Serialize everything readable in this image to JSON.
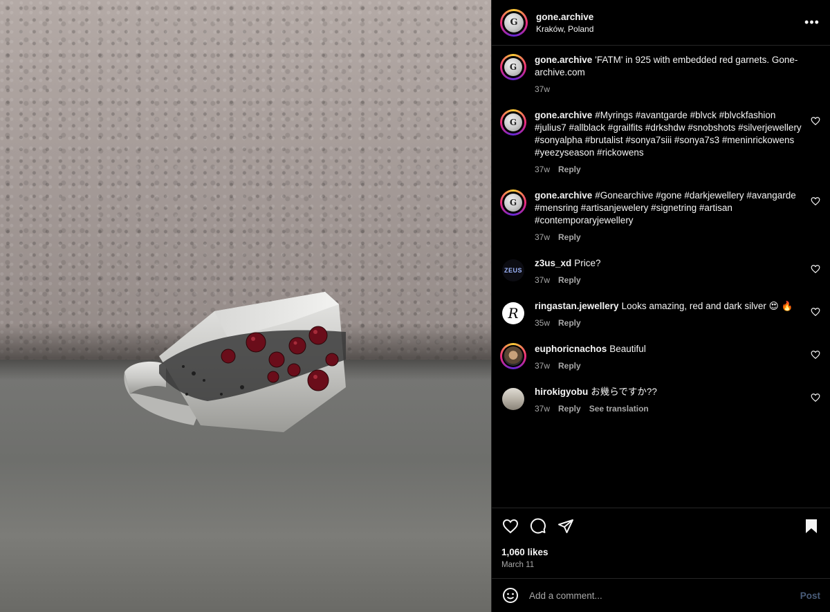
{
  "post": {
    "username": "gone.archive",
    "location": "Kraków, Poland",
    "avatar_letter": "G",
    "more_icon": "more-horizontal-icon"
  },
  "comments": [
    {
      "username": "gone.archive",
      "text": "'FATM' in 925 with embedded red garnets. Gone-archive.com",
      "time": "37w",
      "reply": "",
      "translate": "",
      "caption": true
    },
    {
      "username": "gone.archive",
      "text": "#Myrings #avantgarde #blvck #blvckfashion #julius7 #allblack #grailfits #drkshdw #snobshots #silverjewellery #sonyalpha #brutalist #sonya7siii #sonya7s3 #meninrickowens #yeezyseason #rickowens",
      "time": "37w",
      "reply": "Reply",
      "translate": ""
    },
    {
      "username": "gone.archive",
      "text": "#Gonearchive #gone #darkjewellery #avangarde #mensring #artisanjewelery #signetring #artisan #contemporaryjewellery",
      "time": "37w",
      "reply": "Reply",
      "translate": ""
    },
    {
      "username": "z3us_xd",
      "text": "Price?",
      "time": "37w",
      "reply": "Reply",
      "translate": "",
      "avatar_text": "ZEUS"
    },
    {
      "username": "ringastan.jewellery",
      "text": "Looks amazing, red and dark silver 😍 🔥",
      "time": "35w",
      "reply": "Reply",
      "translate": "",
      "avatar_text": "R"
    },
    {
      "username": "euphoricnachos",
      "text": "Beautiful",
      "time": "37w",
      "reply": "Reply",
      "translate": ""
    },
    {
      "username": "hirokigyobu",
      "text": "お幾らですか??",
      "time": "37w",
      "reply": "Reply",
      "translate": "See translation"
    }
  ],
  "footer": {
    "likes": "1,060 likes",
    "date": "March 11"
  },
  "add_comment": {
    "placeholder": "Add a comment...",
    "post_label": "Post"
  },
  "colors": {
    "background": "#000000",
    "text": "#f5f5f5",
    "muted": "#a8a8a8",
    "post_disabled": "#4a5d7a"
  }
}
